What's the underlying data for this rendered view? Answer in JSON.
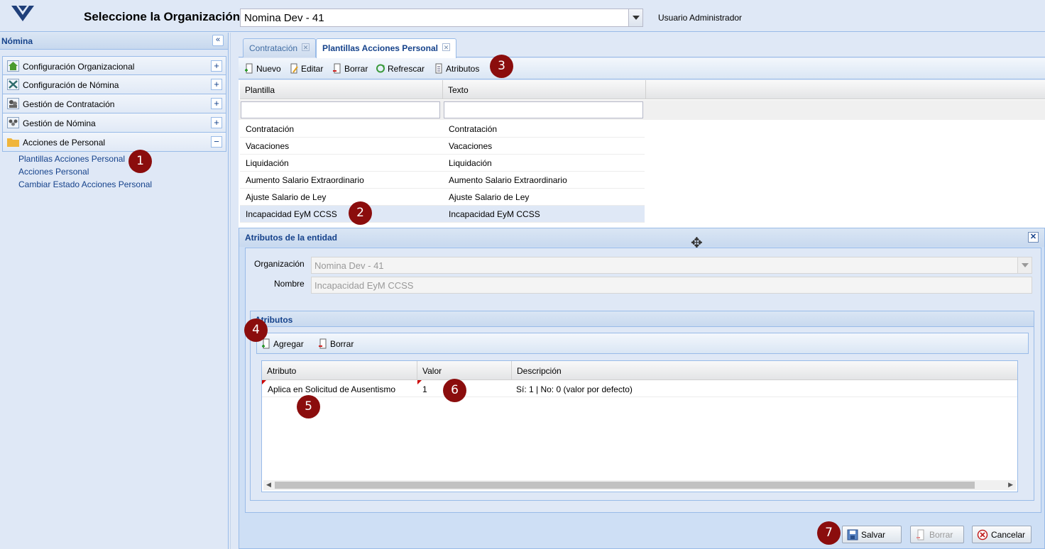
{
  "header": {
    "org_label": "Seleccione la Organización:",
    "org_value": "Nomina Dev - 41",
    "user": "Usuario Administrador"
  },
  "sidebar": {
    "title": "Nómina",
    "items": [
      {
        "label": "Configuración Organizacional",
        "toggle": "+"
      },
      {
        "label": "Configuración de Nómina",
        "toggle": "+"
      },
      {
        "label": "Gestión de Contratación",
        "toggle": "+"
      },
      {
        "label": "Gestión de Nómina",
        "toggle": "+"
      },
      {
        "label": "Acciones de Personal",
        "toggle": "−"
      }
    ],
    "sublinks": [
      "Plantillas Acciones Personal",
      "Acciones Personal",
      "Cambiar Estado Acciones Personal"
    ]
  },
  "tabs": [
    {
      "label": "Contratación"
    },
    {
      "label": "Plantillas Acciones Personal"
    }
  ],
  "toolbar": {
    "nuevo": "Nuevo",
    "editar": "Editar",
    "borrar": "Borrar",
    "refrescar": "Refrescar",
    "atributos": "Atributos"
  },
  "grid": {
    "columns": [
      "Plantilla",
      "Texto"
    ],
    "rows": [
      [
        "Contratación",
        "Contratación"
      ],
      [
        "Vacaciones",
        "Vacaciones"
      ],
      [
        "Liquidación",
        "Liquidación"
      ],
      [
        "Aumento Salario Extraordinario",
        "Aumento Salario Extraordinario"
      ],
      [
        "Ajuste Salario de Ley",
        "Ajuste Salario de Ley"
      ],
      [
        "Incapacidad EyM CCSS",
        "Incapacidad EyM CCSS"
      ]
    ]
  },
  "dialog": {
    "title": "Atributos de la entidad",
    "org_label": "Organización",
    "org_value": "Nomina Dev - 41",
    "name_label": "Nombre",
    "name_value": "Incapacidad EyM CCSS",
    "fieldset_title": "Atributos",
    "agregar": "Agregar",
    "borrar": "Borrar",
    "columns": [
      "Atributo",
      "Valor",
      "Descripción"
    ],
    "rows": [
      [
        "Aplica en Solicitud de Ausentismo",
        "1",
        "Sí: 1 | No: 0 (valor por defecto)"
      ]
    ],
    "salvar": "Salvar",
    "borrar_btn": "Borrar",
    "cancelar": "Cancelar"
  },
  "markers": [
    "1",
    "2",
    "3",
    "4",
    "5",
    "6",
    "7"
  ],
  "colors": {
    "accent": "#15428b",
    "marker": "#8b0d0d",
    "panel_bg": "#dfe8f6"
  }
}
